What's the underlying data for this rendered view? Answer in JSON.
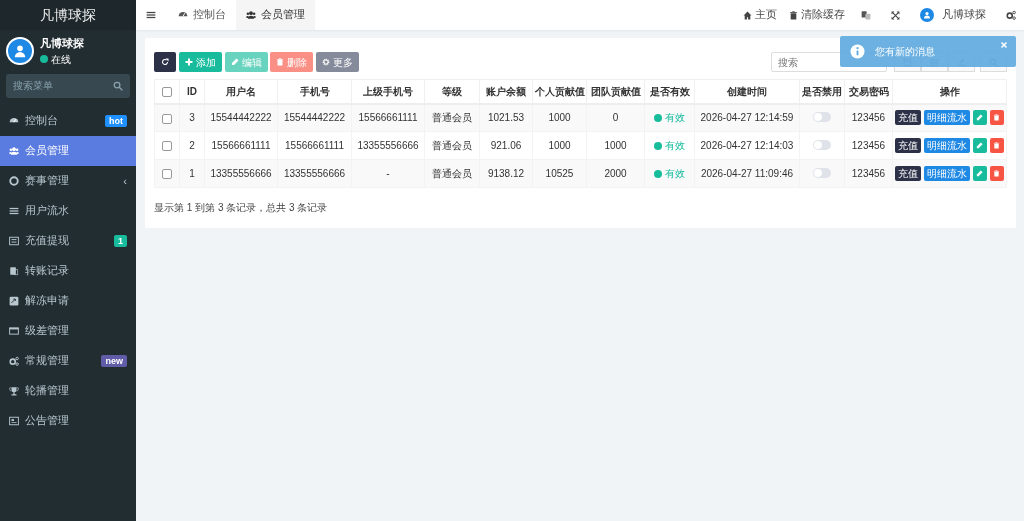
{
  "sidebar": {
    "brand": "凡博球探",
    "user": {
      "name": "凡博球探",
      "status": "在线",
      "online": true
    },
    "search_placeholder": "搜索菜单",
    "items": [
      {
        "label": "控制台",
        "selected": false,
        "badge": {
          "text": "hot",
          "color": "#1e90ff"
        }
      },
      {
        "label": "会员管理",
        "selected": true
      },
      {
        "label": "赛事管理",
        "selected": false,
        "caret": "‹"
      },
      {
        "label": "用户流水",
        "selected": false
      },
      {
        "label": "充值提现",
        "selected": false,
        "badge": {
          "text": "1",
          "color": "#18bc9c"
        }
      },
      {
        "label": "转账记录",
        "selected": false
      },
      {
        "label": "解冻申请",
        "selected": false
      },
      {
        "label": "级差管理",
        "selected": false
      },
      {
        "label": "常规管理",
        "selected": false,
        "badge": {
          "text": "new",
          "color": "#605ca8"
        }
      },
      {
        "label": "轮播管理",
        "selected": false
      },
      {
        "label": "公告管理",
        "selected": false
      }
    ]
  },
  "header": {
    "tabs": [
      {
        "label": "控制台",
        "selected": false
      },
      {
        "label": "会员管理",
        "selected": true
      }
    ],
    "links": [
      "主页",
      "清除缓存"
    ],
    "user_name": "凡博球探"
  },
  "toolbar": [
    {
      "kind": "icon",
      "disabled": false
    },
    {
      "kind": "text",
      "label": "添加",
      "disabled": false
    },
    {
      "kind": "text",
      "label": "编辑",
      "disabled": true
    },
    {
      "kind": "text",
      "label": "删除",
      "disabled": true
    },
    {
      "kind": "text",
      "label": "更多",
      "disabled": false
    }
  ],
  "search": {
    "placeholder": "搜索"
  },
  "notification": {
    "text": "您有新的消息"
  },
  "table": {
    "all_checked": false,
    "columns": [
      "ID",
      "用户名",
      "手机号",
      "上级手机号",
      "等级",
      "账户余额",
      "个人贡献值",
      "团队贡献值",
      "是否有效",
      "创建时间",
      "是否禁用",
      "交易密码",
      "操作"
    ],
    "rows": [
      {
        "checked": false,
        "id": "3",
        "username": "15544442222",
        "phone": "15544442222",
        "parent_phone": "15566661111",
        "level": "普通会员",
        "balance": "1021.53",
        "personal": "1000",
        "team": "0",
        "valid": true,
        "valid_text": "有效",
        "created": "2026-04-27 12:14:59",
        "banned": false,
        "password": "123456",
        "actions": [
          "充值",
          "明细流水"
        ]
      },
      {
        "checked": false,
        "id": "2",
        "username": "15566661111",
        "phone": "15566661111",
        "parent_phone": "13355556666",
        "level": "普通会员",
        "balance": "921.06",
        "personal": "1000",
        "team": "1000",
        "valid": true,
        "valid_text": "有效",
        "created": "2026-04-27 12:14:03",
        "banned": false,
        "password": "123456",
        "actions": [
          "充值",
          "明细流水"
        ]
      },
      {
        "checked": false,
        "id": "1",
        "username": "13355556666",
        "phone": "13355556666",
        "parent_phone": "-",
        "level": "普通会员",
        "balance": "9138.12",
        "personal": "10525",
        "team": "2000",
        "valid": true,
        "valid_text": "有效",
        "created": "2026-04-27 11:09:46",
        "banned": false,
        "password": "123456",
        "actions": [
          "充值",
          "明细流水"
        ]
      }
    ]
  },
  "pagination_info": "显示第 1 到第 3 条记录，总共 3 条记录"
}
